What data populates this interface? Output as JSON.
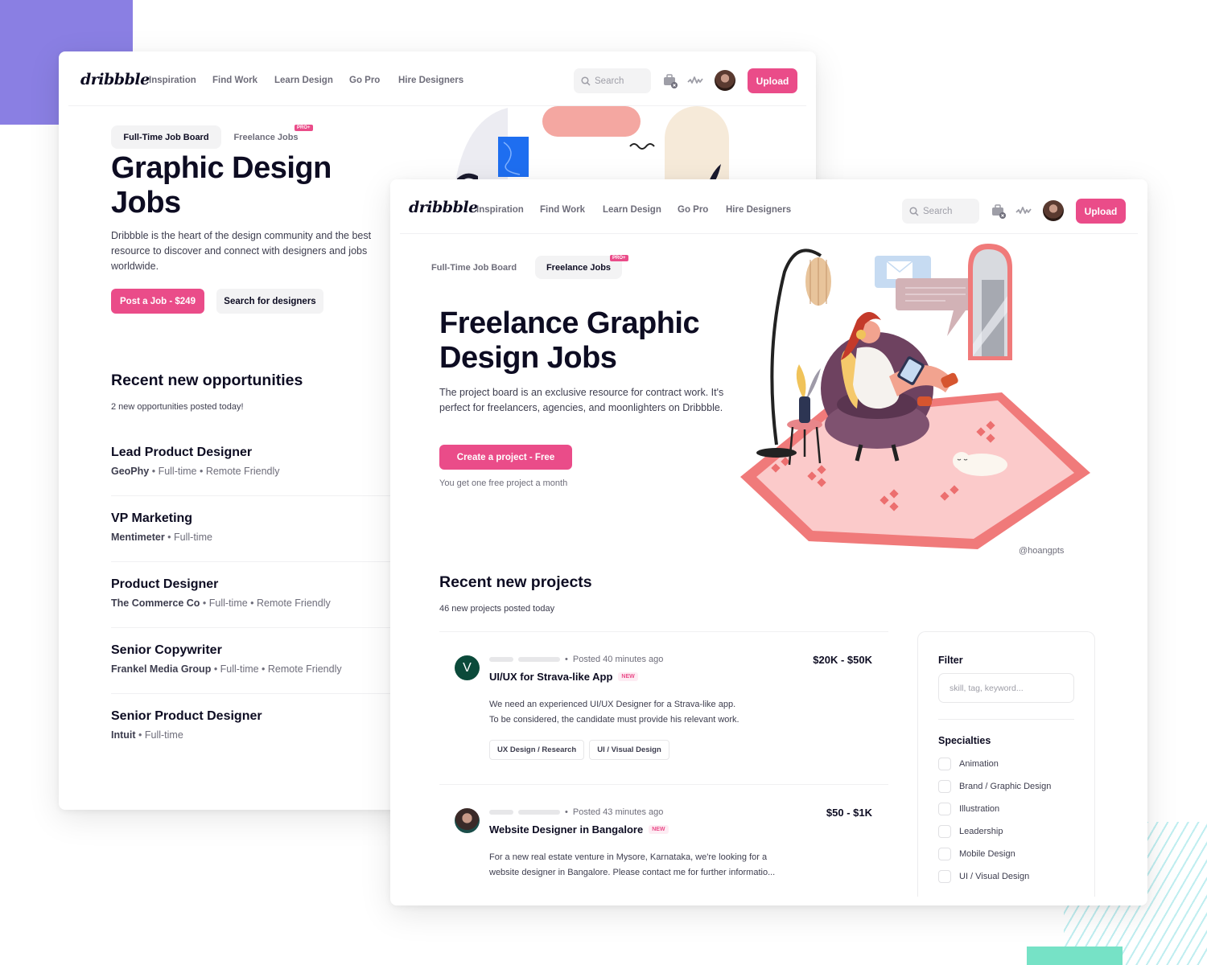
{
  "colors": {
    "brand_pink": "#ea4c89",
    "deco_purple": "#8a7fe3",
    "deco_green": "#76e2c6",
    "deco_stripe": "#bfeef0"
  },
  "nav": {
    "logo": "dribbble",
    "links": [
      "Inspiration",
      "Find Work",
      "Learn Design",
      "Go Pro",
      "Hire Designers"
    ],
    "search_placeholder": "Search",
    "icons": [
      "search-icon",
      "briefcase-icon",
      "activity-icon",
      "avatar"
    ],
    "upload_label": "Upload"
  },
  "back_window": {
    "tabs": [
      {
        "label": "Full-Time Job Board",
        "active": true
      },
      {
        "label": "Freelance Jobs",
        "active": false,
        "badge": "PRO+"
      }
    ],
    "title_line1": "Graphic Design",
    "title_line2": "Jobs",
    "description": "Dribbble is the heart of the design community and the best resource to discover and connect with designers and jobs worldwide.",
    "primary_button": "Post a Job - $249",
    "secondary_button": "Search for designers",
    "section_title": "Recent new opportunities",
    "section_subtitle": "2 new opportunities posted today!",
    "jobs": [
      {
        "title": "Lead Product Designer",
        "company": "GeoPhy",
        "details": " • Full-time • Remote Friendly"
      },
      {
        "title": "VP Marketing",
        "company": "Mentimeter",
        "details": " • Full-time"
      },
      {
        "title": "Product Designer",
        "company": "The Commerce Co",
        "details": " • Full-time • Remote Friendly"
      },
      {
        "title": "Senior Copywriter",
        "company": "Frankel Media Group",
        "details": " • Full-time • Remote Friendly"
      },
      {
        "title": "Senior Product Designer",
        "company": "Intuit",
        "details": " • Full-time"
      }
    ]
  },
  "front_window": {
    "tabs": [
      {
        "label": "Full-Time Job Board",
        "active": false
      },
      {
        "label": "Freelance Jobs",
        "active": true,
        "badge": "PRO+"
      }
    ],
    "title_line1": "Freelance Graphic",
    "title_line2": "Design Jobs",
    "description": "The project board is an exclusive resource for contract work. It's perfect for freelancers, agencies, and moonlighters on Dribbble.",
    "primary_button": "Create a project - Free",
    "button_note": "You get one free project a month",
    "illustration_credit": "@hoangpts",
    "section_title": "Recent new projects",
    "section_subtitle": "46 new projects posted today",
    "projects": [
      {
        "avatar_letter": "V",
        "avatar_color": "#0b4a3a",
        "posted": "Posted 40 minutes ago",
        "title": "UI/UX for Strava-like App",
        "badge": "NEW",
        "price": "$20K - $50K",
        "description_line1": "We need an experienced UI/UX Designer for a Strava-like app.",
        "description_line2": "To be considered, the candidate must provide his relevant work.",
        "tags": [
          "UX Design / Research",
          "UI / Visual Design"
        ]
      },
      {
        "avatar_letter": "",
        "posted": "Posted 43 minutes ago",
        "title": "Website Designer in Bangalore",
        "badge": "NEW",
        "price": "$50 - $1K",
        "description_line1": "For a new real estate venture in Mysore, Karnataka, we're looking for a",
        "description_line2": "website designer in Bangalore. Please contact me for further informatio..."
      }
    ],
    "filter": {
      "label": "Filter",
      "placeholder": "skill, tag, keyword...",
      "specialties_title": "Specialties",
      "specialties": [
        {
          "label": "Animation",
          "checked": false
        },
        {
          "label": "Brand / Graphic Design",
          "checked": false
        },
        {
          "label": "Illustration",
          "checked": false
        },
        {
          "label": "Leadership",
          "checked": false
        },
        {
          "label": "Mobile Design",
          "checked": false
        },
        {
          "label": "UI / Visual Design",
          "checked": false
        }
      ]
    }
  }
}
